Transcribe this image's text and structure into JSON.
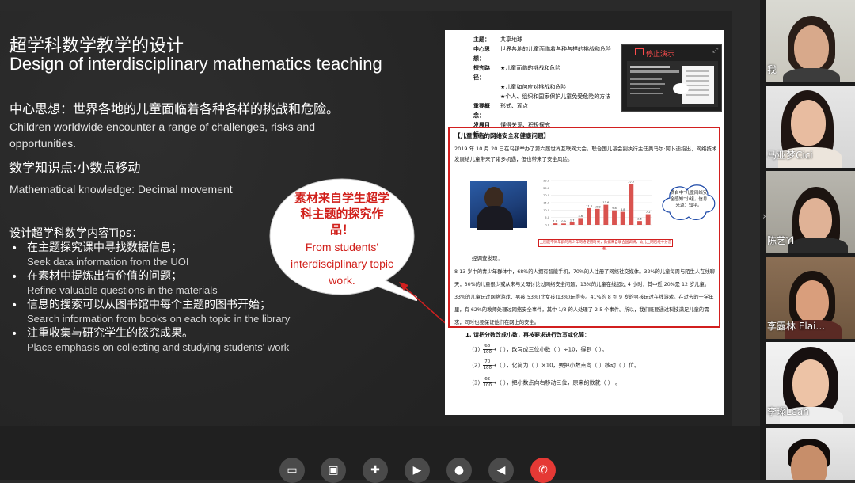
{
  "slide": {
    "title_cn": "超学科数学教学的设计",
    "title_en": "Design of interdisciplinary mathematics teaching",
    "central_idea_cn": "中心思想：世界各地的儿童面临着各种各样的挑战和危险。",
    "central_idea_en": "Children worldwide encounter a range of challenges, risks and opportunities.",
    "knowledge_cn": "数学知识点:小数点移动",
    "knowledge_en": "Mathematical knowledge: Decimal movement",
    "tips_heading": "设计超学科数学内容Tips：",
    "tips": [
      {
        "cn": "在主题探究课中寻找数据信息；",
        "en": "Seek data information from the UOI"
      },
      {
        "cn": "在素材中提炼出有价值的问题；",
        "en": "Refine valuable questions in the materials"
      },
      {
        "cn": "信息的搜索可以从图书馆中每个主题的图书开始；",
        "en": "Search information from books on each topic in the library"
      },
      {
        "cn": "注重收集与研究学生的探究成果。",
        "en": "Place emphasis on collecting and studying students' work"
      }
    ],
    "bubble_cn": "素材来自学生超学科主题的探究作品！",
    "bubble_en": "From students' interdisciplinary topic work."
  },
  "document": {
    "info": [
      {
        "k": "主题：",
        "v": "共享地球"
      },
      {
        "k": "中心思想：",
        "v": "世界各地的儿童面临着各种各样的挑战和危险"
      },
      {
        "k": "探究路径：",
        "v": "★儿童面临的挑战和危险"
      },
      {
        "k": "",
        "v": "★儿童如何应对挑战和危险"
      },
      {
        "k": "",
        "v": "★个人、组织和国家保护儿童免受危险的方法"
      },
      {
        "k": "重要概念：",
        "v": "形式、观点"
      },
      {
        "k": "发展目标：",
        "v": "懂得关爱、积极探究"
      }
    ],
    "box_heading": "【儿童面临的网络安全和健康问题】",
    "para1": "2019 年 10 月 20 日在乌镇举办了第六届世界互联网大会。联合国儿基会副执行主任奥马尔·阿卜迪指出，网络技术发展给儿童带来了诸多机遇，但也带来了安全风险。",
    "cloud_text": "摘自中“儿童网络安全感知”小组，信息来源：知乎。",
    "chart_caption": "上图是不同年龄的青少年网络使用时长，数据来自联合国调研，幼儿上网已经十分普遍。",
    "survey_label": "经调查发现：",
    "para2": "8-13 岁中的青少年群体中，68%的人拥有智能手机，70%的人注册了网络社交媒体。32%的儿童每周与陌生人在线聊天；30%的儿童很少或从未与父母讨论过网络安全问题；13%的儿童在线超过 4 小时，其中近 20%是 12 岁儿童。33%的儿童玩过网络游戏，男孩(53%)比女孩(13%)玩得多。41%的 8 到 9 岁的男孩玩过在线游戏。在过去的一学年里，有 62%的教师处理过网络安全事件，其中 1/3 的人处理了 2-5 个事件。所以，我们既要通过科技满足儿童的需求，同时也要保证他们在网上的安全。",
    "q_title": "1. 请把分数改成小数，再按要求进行改写或化简：",
    "questions": [
      {
        "n": "（1）",
        "num": "68",
        "den": "100",
        "text": "→（        ），改写成三位小数（        ）÷10，得到（        ）。"
      },
      {
        "n": "（2）",
        "num": "70",
        "den": "100",
        "text": "→（        ），化简为（        ）×10，要把小数点向（        ）移动（        ）位。"
      },
      {
        "n": "（3）",
        "num": "62",
        "den": "100",
        "text": "→（        ），把小数点向右移动三位，原来的数就（        ）                    。"
      }
    ]
  },
  "chart_data": {
    "type": "bar",
    "values": [
      1.0,
      0.9,
      1.7,
      4.6,
      11.3,
      10.8,
      13.6,
      9.8,
      8.8,
      27.7,
      2.6,
      7.2
    ],
    "ylim": [
      0,
      30
    ],
    "yticks": [
      "30.0",
      "25.0",
      "20.0",
      "15.0",
      "10.0",
      "5.0",
      "0.0"
    ],
    "color": "#d9534f"
  },
  "popup": {
    "stop_label": "停止演示"
  },
  "participants": [
    {
      "name": "我"
    },
    {
      "name": "马亚梦Cici"
    },
    {
      "name": "陈艺Yi"
    },
    {
      "name": "李露林 Elai…"
    },
    {
      "name": "李璨Leah"
    },
    {
      "name": ""
    }
  ],
  "controls": [
    {
      "icon": "share-screen-icon",
      "glyph": "▭"
    },
    {
      "icon": "share-window-icon",
      "glyph": "▣"
    },
    {
      "icon": "add-participant-icon",
      "glyph": "👤"
    },
    {
      "icon": "camera-off-icon",
      "glyph": "▶"
    },
    {
      "icon": "microphone-icon",
      "glyph": "🎤"
    },
    {
      "icon": "speaker-icon",
      "glyph": "🔊"
    },
    {
      "icon": "hang-up-icon",
      "glyph": "✆"
    }
  ]
}
